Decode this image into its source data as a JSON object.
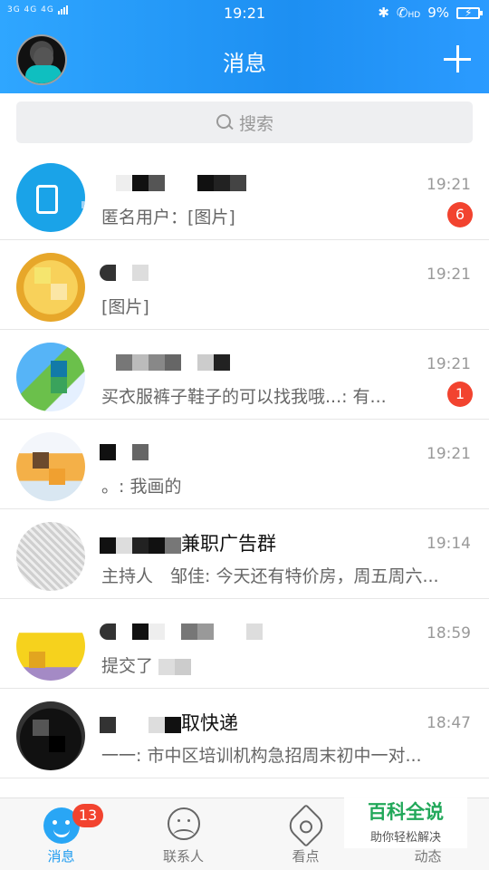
{
  "status_bar": {
    "signal_text": "3G 4G 4G",
    "time": "19:21",
    "icons": [
      "bluetooth-icon",
      "hd-call-icon"
    ],
    "hd_label": "HD",
    "battery": "9%"
  },
  "header": {
    "title": "消息",
    "add_icon": "plus-icon"
  },
  "search": {
    "placeholder": "搜索"
  },
  "conversations": [
    {
      "time": "19:21",
      "message": "匿名用户：[图片]",
      "badge": "6"
    },
    {
      "time": "19:21",
      "message": "[图片]",
      "badge": ""
    },
    {
      "time": "19:21",
      "message": "买衣服裤子鞋子的可以找我哦...: 有...",
      "badge": "1"
    },
    {
      "time": "19:21",
      "message": "。: 我画的",
      "badge": ""
    },
    {
      "name_suffix": "兼职广告群",
      "time": "19:14",
      "message": "主持人　邹佳: 今天还有特价房，周五周六...",
      "badge": ""
    },
    {
      "time": "18:59",
      "message": "提交了",
      "badge": ""
    },
    {
      "name_suffix": "取快递",
      "time": "18:47",
      "message": "一一: 市中区培训机构急招周末初中一对...",
      "badge": ""
    }
  ],
  "bottom_nav": {
    "messages": {
      "label": "消息",
      "badge": "13"
    },
    "contacts": {
      "label": "联系人"
    },
    "watch": {
      "label": "看点"
    },
    "feed": {
      "label": "动态"
    }
  },
  "watermark": {
    "title": "百科全说",
    "subtitle": "助你轻松解决"
  },
  "colors": {
    "header_blue": "#1d8ff2",
    "badge_red": "#f2432f",
    "watermark_green": "#22a85a"
  }
}
